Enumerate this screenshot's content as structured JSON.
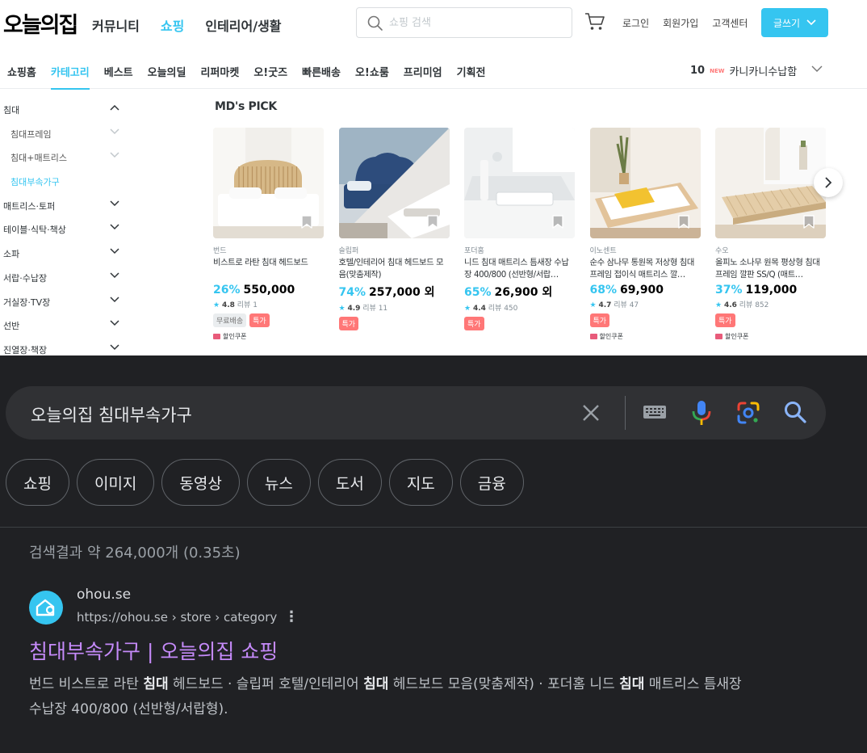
{
  "site": {
    "logo": "오늘의집",
    "main_nav": [
      "커뮤니티",
      "쇼핑",
      "인테리어/생활"
    ],
    "main_nav_active": 1,
    "search_placeholder": "쇼핑 검색",
    "util_links": [
      "로그인",
      "회원가입",
      "고객센터"
    ],
    "write_button": "글쓰기",
    "sub_nav": [
      "쇼핑홈",
      "카테고리",
      "베스트",
      "오늘의딜",
      "리퍼마켓",
      "오!굿즈",
      "빠른배송",
      "오!쇼룸",
      "프리미엄",
      "기획전"
    ],
    "sub_nav_active": 1,
    "ranking": {
      "rank": "10",
      "new_label": "NEW",
      "keyword": "카니카니수납함"
    },
    "colors": {
      "accent": "#35c5f0",
      "sale_badge": "#ff7777"
    }
  },
  "sidebar": [
    {
      "label": "침대",
      "expanded": true,
      "sub": false,
      "active": false
    },
    {
      "label": "침대프레임",
      "sub": true,
      "active": false,
      "has_chevron": true
    },
    {
      "label": "침대+매트리스",
      "sub": true,
      "active": false,
      "has_chevron": true
    },
    {
      "label": "침대부속가구",
      "sub": true,
      "active": true,
      "has_chevron": false
    },
    {
      "label": "매트리스·토퍼",
      "sub": false,
      "active": false
    },
    {
      "label": "테이블·식탁·책상",
      "sub": false,
      "active": false
    },
    {
      "label": "소파",
      "sub": false,
      "active": false
    },
    {
      "label": "서랍·수납장",
      "sub": false,
      "active": false
    },
    {
      "label": "거실장·TV장",
      "sub": false,
      "active": false
    },
    {
      "label": "선반",
      "sub": false,
      "active": false
    },
    {
      "label": "진열장·책장",
      "sub": false,
      "active": false
    }
  ],
  "md_pick": {
    "title": "MD's PICK",
    "products": [
      {
        "brand": "번드",
        "name": "비스트로 라탄 침대 헤드보드",
        "discount": "26%",
        "price": "550,000",
        "rating": "4.8",
        "reviews": "리뷰 1",
        "free_shipping": "무료배송",
        "special": "특가",
        "coupon": "할인쿠폰"
      },
      {
        "brand": "슬립퍼",
        "name": "호텔/인테리어 침대 헤드보드 모음(맞춤제작)",
        "discount": "74%",
        "price": "257,000 외",
        "rating": "4.9",
        "reviews": "리뷰 11",
        "special": "특가"
      },
      {
        "brand": "포더홈",
        "name": "니드 침대 매트리스 틈새장 수납장 400/800 (선반형/서랍…",
        "discount": "65%",
        "price": "26,900 외",
        "rating": "4.4",
        "reviews": "리뷰 450",
        "special": "특가"
      },
      {
        "brand": "이노센트",
        "name": "순수 삼나무 통원목 저상형 침대프레임 접이식 매트리스 깔…",
        "discount": "68%",
        "price": "69,900",
        "rating": "4.7",
        "reviews": "리뷰 47",
        "special": "특가",
        "coupon": "할인쿠폰"
      },
      {
        "brand": "수오",
        "name": "올피노 소나무 원목 평상형 침대 프레임 깔판 SS/Q (매트…",
        "discount": "37%",
        "price": "119,000",
        "rating": "4.6",
        "reviews": "리뷰 852",
        "special": "특가",
        "coupon": "할인쿠폰"
      }
    ]
  },
  "google": {
    "query": "오늘의집 침대부속가구",
    "tabs": [
      "쇼핑",
      "이미지",
      "동영상",
      "뉴스",
      "도서",
      "지도",
      "금융"
    ],
    "result_stats": "검색결과 약 264,000개 (0.35초)",
    "result": {
      "site_name": "ohou.se",
      "url": "https://ohou.se › store › category",
      "title": "침대부속가구 | 오늘의집 쇼핑",
      "snippet_parts": [
        {
          "t": "번드 비스트로 라탄 ",
          "b": false
        },
        {
          "t": "침대",
          "b": true
        },
        {
          "t": " 헤드보드 · 슬립퍼 호텔/인테리어 ",
          "b": false
        },
        {
          "t": "침대",
          "b": true
        },
        {
          "t": " 헤드보드 모음(맞춤제작) · 포더홈 니드 ",
          "b": false
        },
        {
          "t": "침대",
          "b": true
        },
        {
          "t": " 매트리스 틈새장 수납장 400/800 (선반형/서랍형).",
          "b": false
        }
      ]
    },
    "colors": {
      "bg": "#202124",
      "title_link": "#c58af9"
    }
  }
}
